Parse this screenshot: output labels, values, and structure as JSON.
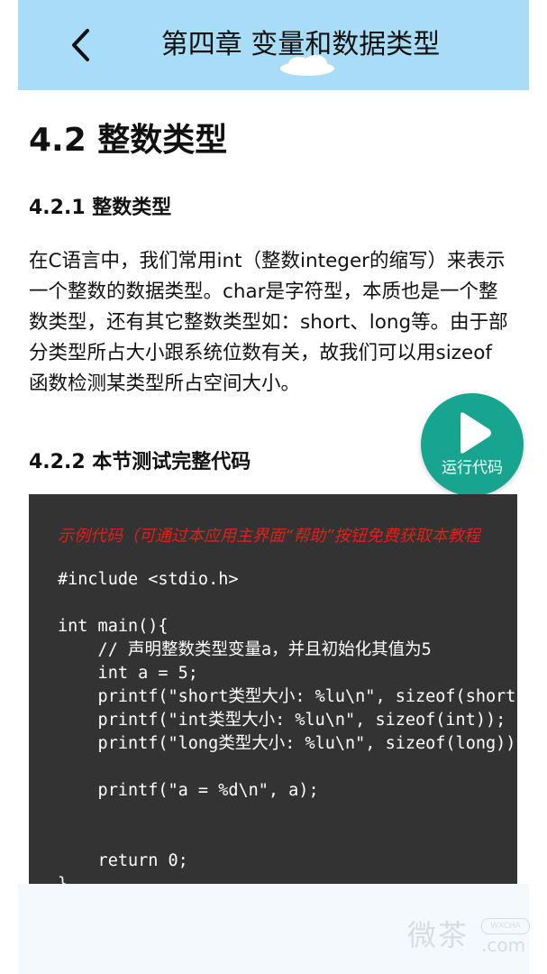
{
  "header": {
    "title": "第四章 变量和数据类型",
    "back_icon": "chevron-left-icon",
    "bg_color": "#a9dcf6"
  },
  "article": {
    "section_title": "4.2 整数类型",
    "subsection1": "4.2.1 整数类型",
    "paragraph": "在C语言中，我们常用int（整数integer的缩写）来表示一个整数的数据类型。char是字符型，本质也是一个整数类型，还有其它整数类型如：short、long等。由于部分类型所占大小跟系统位数有关，故我们可以用sizeof函数检测某类型所占空间大小。",
    "subsection2": "4.2.2 本节测试完整代码"
  },
  "run_button": {
    "label": "运行代码",
    "icon": "play-icon",
    "color": "#18a58f"
  },
  "code": {
    "note": "示例代码（可通过本应用主界面“帮助”按钮免费获取本教程",
    "lines": [
      "#include <stdio.h>",
      "",
      "int main(){",
      "    // 声明整数类型变量a，并且初始化其值为5",
      "    int a = 5;",
      "    printf(\"short类型大小: %lu\\n\", sizeof(short));",
      "    printf(\"int类型大小: %lu\\n\", sizeof(int));",
      "    printf(\"long类型大小: %lu\\n\", sizeof(long));",
      "",
      "    printf(\"a = %d\\n\", a);",
      "",
      "",
      "    return 0;",
      "}"
    ],
    "bg_color": "#333333",
    "note_color": "#e0201a"
  },
  "watermark": {
    "text": "微茶",
    "badge": "WXCHA",
    "url": ".com"
  }
}
